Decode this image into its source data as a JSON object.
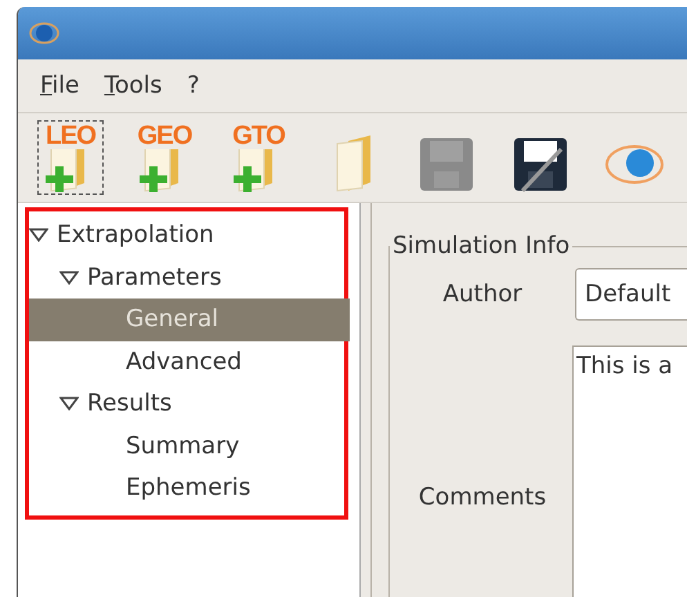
{
  "menu": [
    {
      "label": "File",
      "mnemonic": true
    },
    {
      "label": "Tools",
      "mnemonic": true
    },
    {
      "label": "?",
      "mnemonic": false
    }
  ],
  "toolbar": [
    {
      "kind": "new-orbit",
      "label": "LEO",
      "focused": true
    },
    {
      "kind": "new-orbit",
      "label": "GEO",
      "focused": false
    },
    {
      "kind": "new-orbit",
      "label": "GTO",
      "focused": false
    },
    {
      "kind": "open",
      "focused": false
    },
    {
      "kind": "save",
      "focused": false,
      "disabled": true
    },
    {
      "kind": "save-as",
      "focused": false,
      "disabled": false
    },
    {
      "kind": "logo",
      "focused": false
    }
  ],
  "tree": [
    {
      "label": "Extrapolation",
      "expanded": true,
      "selected": false,
      "children": [
        {
          "label": "Parameters",
          "expanded": true,
          "selected": false,
          "children": [
            {
              "label": "General",
              "selected": true
            },
            {
              "label": "Advanced",
              "selected": false
            }
          ]
        },
        {
          "label": "Results",
          "expanded": true,
          "selected": false,
          "children": [
            {
              "label": "Summary",
              "selected": false
            },
            {
              "label": "Ephemeris",
              "selected": false
            }
          ]
        }
      ]
    }
  ],
  "simulation_info": {
    "title": "Simulation Info",
    "author_label": "Author",
    "author_value": "Default",
    "comments_label": "Comments",
    "comments_value": "This is a"
  }
}
